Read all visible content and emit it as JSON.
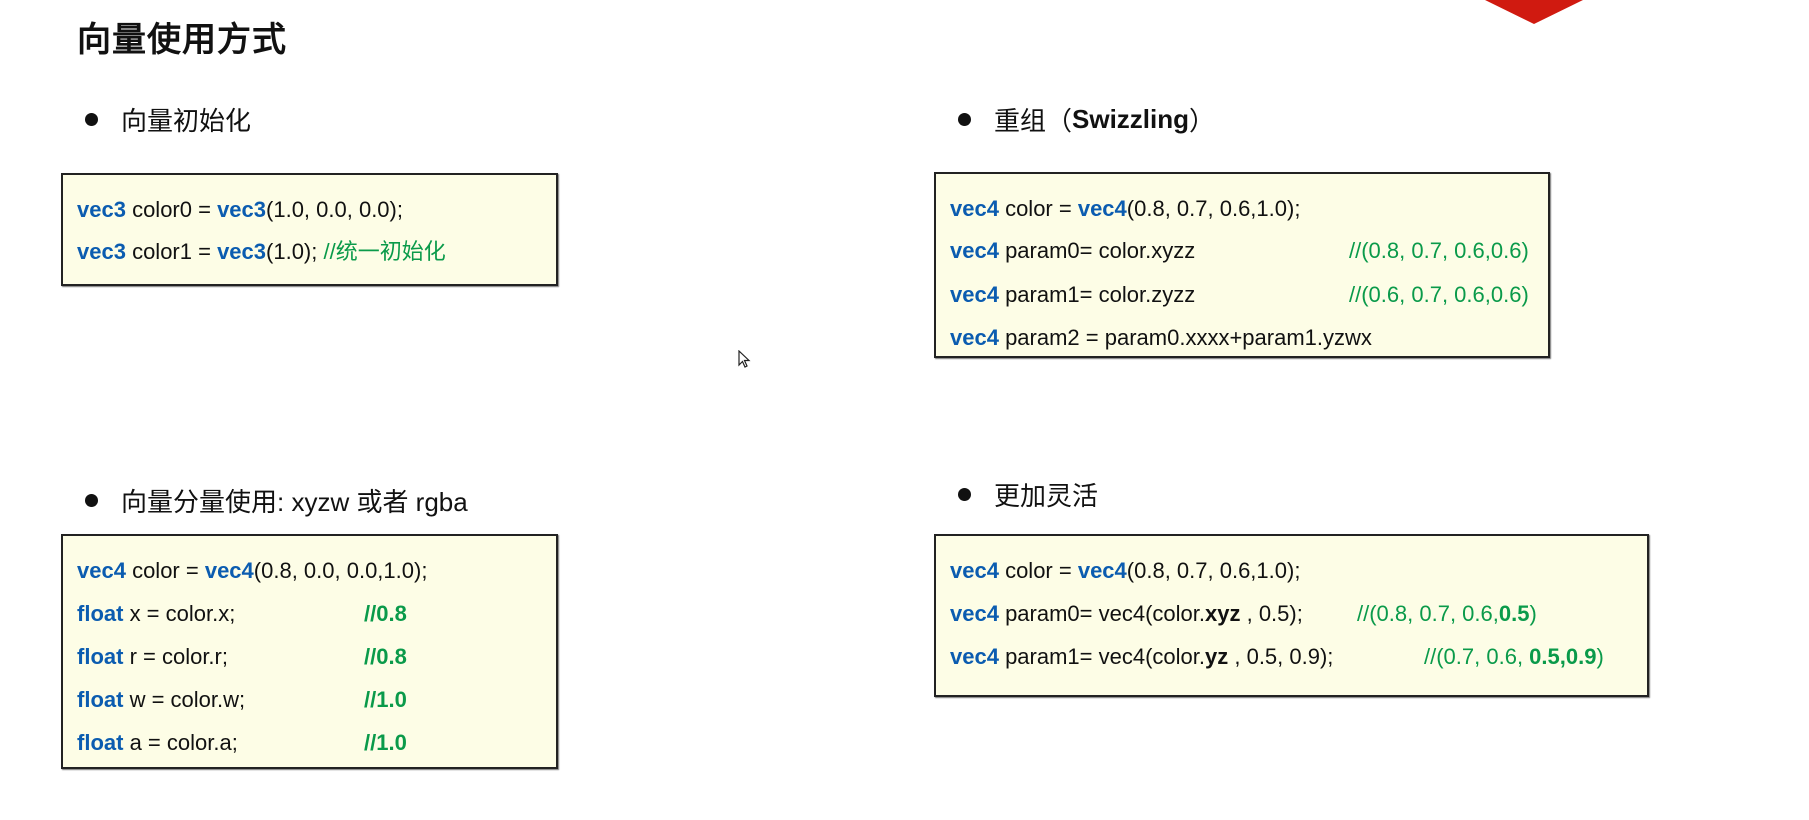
{
  "title": "向量使用方式",
  "accent_colors": {
    "keyword": "#0b5cb0",
    "comment": "#0a9a4a",
    "box_bg": "#fdfde6",
    "decoration_red": "#d01a10"
  },
  "sections": [
    {
      "heading": "向量初始化",
      "lines": [
        {
          "code": [
            {
              "t": "vec3",
              "k": "kw"
            },
            {
              "t": " color0 = ",
              "k": "pl"
            },
            {
              "t": "vec3",
              "k": "kw"
            },
            {
              "t": "(1.0, 0.0, 0.0);",
              "k": "pl"
            }
          ],
          "comment": []
        },
        {
          "code": [
            {
              "t": "vec3",
              "k": "kw"
            },
            {
              "t": " color1 = ",
              "k": "pl"
            },
            {
              "t": "vec3",
              "k": "kw"
            },
            {
              "t": "(1.0); ",
              "k": "pl"
            },
            {
              "t": "//统一初始化",
              "k": "cm"
            }
          ],
          "comment": []
        }
      ]
    },
    {
      "heading_parts": [
        "重组（",
        "Swizzling",
        "）"
      ],
      "lines": [
        {
          "code": [
            {
              "t": "vec4",
              "k": "kw"
            },
            {
              "t": " color = ",
              "k": "pl"
            },
            {
              "t": "vec4",
              "k": "kw"
            },
            {
              "t": "(0.8, 0.7, 0.6,1.0);",
              "k": "pl"
            }
          ],
          "comment": []
        },
        {
          "code": [
            {
              "t": "vec4",
              "k": "kw"
            },
            {
              "t": " param0= color.xyzz",
              "k": "pl"
            }
          ],
          "comment": [
            {
              "t": "//(0.8, 0.7, 0.6,0.6)",
              "k": "cm"
            }
          ]
        },
        {
          "code": [
            {
              "t": "vec4",
              "k": "kw"
            },
            {
              "t": " param1= color.zyzz",
              "k": "pl"
            }
          ],
          "comment": [
            {
              "t": "//(0.6, 0.7, 0.6,0.6)",
              "k": "cm"
            }
          ]
        },
        {
          "code": [
            {
              "t": "vec4",
              "k": "kw"
            },
            {
              "t": " param2 = param0.xxxx+param1.yzwx",
              "k": "pl"
            }
          ],
          "comment": []
        }
      ]
    },
    {
      "heading": "向量分量使用: xyzw 或者 rgba",
      "lines": [
        {
          "code": [
            {
              "t": "vec4",
              "k": "kw"
            },
            {
              "t": " color = ",
              "k": "pl"
            },
            {
              "t": "vec4",
              "k": "kw"
            },
            {
              "t": "(0.8, 0.0, 0.0,1.0);",
              "k": "pl"
            }
          ],
          "comment": []
        },
        {
          "code": [
            {
              "t": "float",
              "k": "kw"
            },
            {
              "t": " x = color.x;",
              "k": "pl"
            }
          ],
          "comment": [
            {
              "t": "//0.8",
              "k": "cmb"
            }
          ]
        },
        {
          "code": [
            {
              "t": "float",
              "k": "kw"
            },
            {
              "t": " r = color.r;",
              "k": "pl"
            }
          ],
          "comment": [
            {
              "t": "//0.8",
              "k": "cmb"
            }
          ]
        },
        {
          "code": [
            {
              "t": "float",
              "k": "kw"
            },
            {
              "t": " w = color.w;",
              "k": "pl"
            }
          ],
          "comment": [
            {
              "t": "//1.0",
              "k": "cmb"
            }
          ]
        },
        {
          "code": [
            {
              "t": "float",
              "k": "kw"
            },
            {
              "t": " a = color.a;",
              "k": "pl"
            }
          ],
          "comment": [
            {
              "t": "//1.0",
              "k": "cmb"
            }
          ]
        }
      ]
    },
    {
      "heading": "更加灵活",
      "lines": [
        {
          "code": [
            {
              "t": "vec4",
              "k": "kw"
            },
            {
              "t": " color = ",
              "k": "pl"
            },
            {
              "t": "vec4",
              "k": "kw"
            },
            {
              "t": "(0.8, 0.7, 0.6,1.0);",
              "k": "pl"
            }
          ],
          "comment": []
        },
        {
          "code": [
            {
              "t": "vec4",
              "k": "kw"
            },
            {
              "t": " param0= vec4(color.",
              "k": "pl"
            },
            {
              "t": "xyz",
              "k": "b"
            },
            {
              "t": " , 0.5);",
              "k": "pl"
            }
          ],
          "comment": [
            {
              "t": "//(0.8, 0.7, 0.6,",
              "k": "cm"
            },
            {
              "t": "0.5",
              "k": "cmb"
            },
            {
              "t": ")",
              "k": "cm"
            }
          ]
        },
        {
          "code": [
            {
              "t": "vec4",
              "k": "kw"
            },
            {
              "t": " param1= vec4(color.",
              "k": "pl"
            },
            {
              "t": "yz",
              "k": "b"
            },
            {
              "t": " , 0.5, 0.9);",
              "k": "pl"
            }
          ],
          "comment": [
            {
              "t": "//(0.7, 0.6, ",
              "k": "cm"
            },
            {
              "t": "0.5,0.9",
              "k": "cmb"
            },
            {
              "t": ")",
              "k": "cm"
            }
          ]
        }
      ]
    }
  ]
}
